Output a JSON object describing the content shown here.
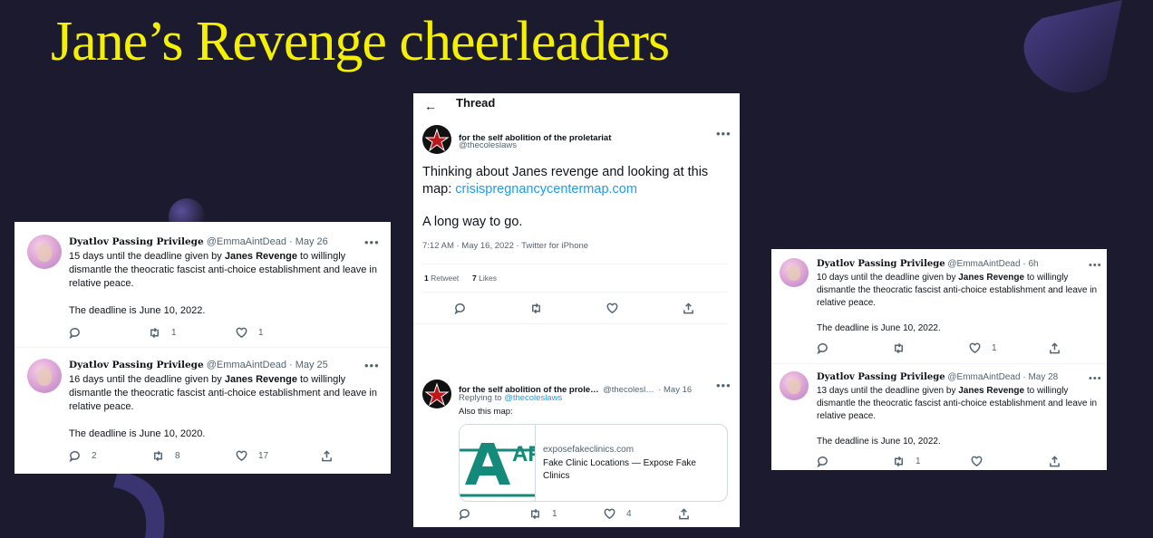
{
  "slide": {
    "title": "Jane’s Revenge cheerleaders"
  },
  "left_panel": {
    "tweets": [
      {
        "name": "Dyatlov Passing Privilege",
        "handle": "@EmmaAintDead",
        "date": "· May 26",
        "pre": "15 days until the deadline given by ",
        "bold": "Janes Revenge",
        "post": " to willingly dismantle the theocratic fascist anti-choice establishment and leave in relative peace.",
        "deadline": "The deadline is June 10, 2022.",
        "replies": "",
        "retweets": "1",
        "likes": "1"
      },
      {
        "name": "Dyatlov Passing Privilege",
        "handle": "@EmmaAintDead",
        "date": "· May 25",
        "pre": "16 days until the deadline given by ",
        "bold": "Janes Revenge",
        "post": " to willingly dismantle the theocratic fascist anti-choice establishment and leave in relative peace.",
        "deadline": "The deadline is June 10, 2020.",
        "replies": "2",
        "retweets": "8",
        "likes": "17"
      }
    ]
  },
  "center_panel": {
    "header": {
      "back": "←",
      "title": "Thread"
    },
    "main_tweet": {
      "name": "for the self abolition of the proletariat",
      "handle": "@thecoleslaws",
      "text": "Thinking about Janes revenge and looking at this map: ",
      "link": "crisispregnancycentermap.com",
      "text2": "A long way to go.",
      "meta": "7:12 AM · May 16, 2022 · Twitter for iPhone",
      "retweet_count": "1",
      "retweet_label": "Retweet",
      "like_count": "7",
      "like_label": "Likes"
    },
    "reply": {
      "name": "for the self abolition of the prole…",
      "handle": "@thecolesl…",
      "date": "· May 16",
      "replying_label": "Replying to ",
      "replying_handle": "@thecoleslaws",
      "text": "Also this map:",
      "card_domain": "exposefakeclinics.com",
      "card_title": "Fake Clinic Locations — Expose Fake Clinics",
      "card_logo_text": "AF",
      "retweets": "1",
      "likes": "4"
    }
  },
  "right_panel": {
    "tweets": [
      {
        "name": "Dyatlov Passing Privilege",
        "handle": "@EmmaAintDead",
        "date": "· 6h",
        "pre": "10 days until the deadline given by ",
        "bold": "Janes Revenge",
        "post": " to willingly dismantle the theocratic fascist anti-choice establishment and leave in relative peace.",
        "deadline": "The deadline is June 10, 2022.",
        "replies": "",
        "retweets": "",
        "likes": "1"
      },
      {
        "name": "Dyatlov Passing Privilege",
        "handle": "@EmmaAintDead",
        "date": "· May 28",
        "pre": "13 days until the deadline given by ",
        "bold": "Janes Revenge",
        "post": " to willingly dismantle the theocratic fascist anti-choice establishment and leave in relative peace.",
        "deadline": "The deadline is June 10, 2022.",
        "replies": "",
        "retweets": "1",
        "likes": ""
      }
    ]
  },
  "colors": {
    "title": "#f4f000",
    "background": "#1c1a2e",
    "link": "#1d9bf0"
  },
  "icons": [
    "reply-icon",
    "retweet-icon",
    "like-icon",
    "share-icon",
    "more-icon",
    "back-arrow-icon"
  ]
}
